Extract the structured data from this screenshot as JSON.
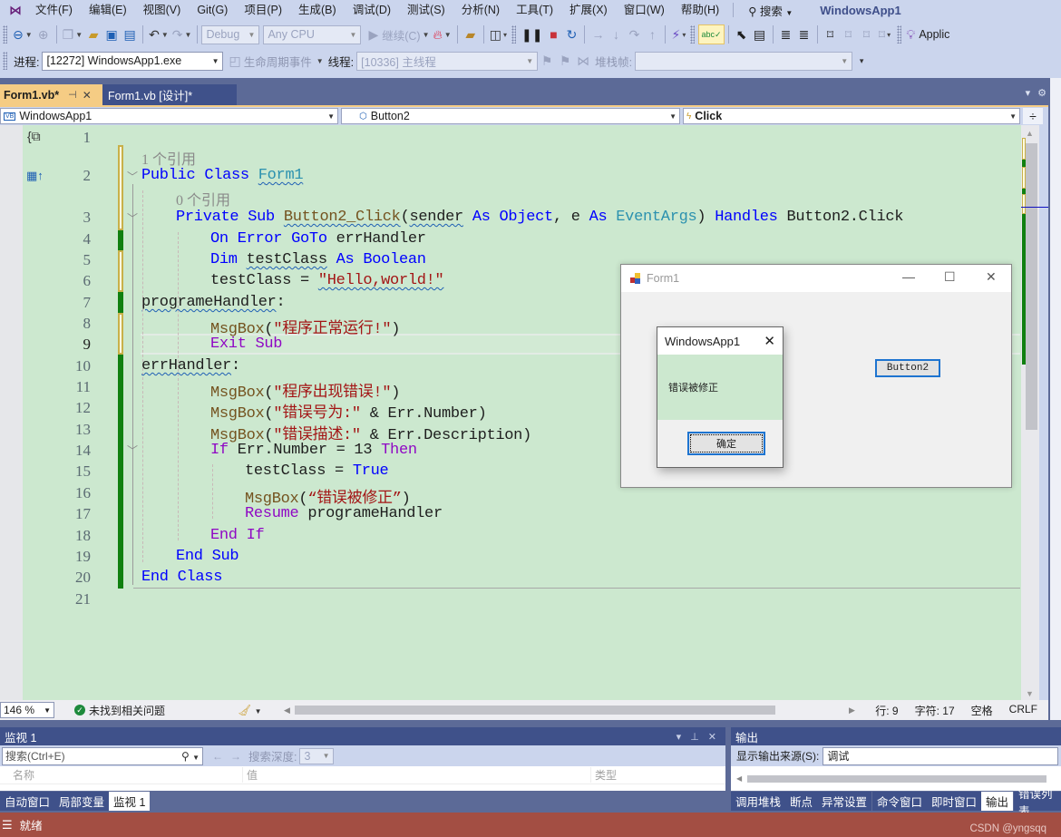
{
  "menubar": {
    "items": [
      "文件(F)",
      "编辑(E)",
      "视图(V)",
      "Git(G)",
      "项目(P)",
      "生成(B)",
      "调试(D)",
      "测试(S)",
      "分析(N)",
      "工具(T)",
      "扩展(X)",
      "窗口(W)",
      "帮助(H)"
    ],
    "search_label": "搜索",
    "app_title": "WindowsApp1"
  },
  "toolbar": {
    "config": "Debug",
    "platform": "Any CPU",
    "continue_label": "继续(C)",
    "applic_label": "Applic"
  },
  "debugbar": {
    "process_label": "进程:",
    "process_value": "[12272] WindowsApp1.exe",
    "lifecycle_label": "生命周期事件",
    "thread_label": "线程:",
    "thread_value": "[10336] 主线程",
    "stackframe_label": "堆栈帧:",
    "stackframe_value": ""
  },
  "tabs": [
    {
      "label": "Form1.vb*",
      "active": true
    },
    {
      "label": "Form1.vb [设计]*",
      "active": false
    }
  ],
  "navbar": {
    "project": "WindowsApp1",
    "object": "Button2",
    "event": "Click"
  },
  "editor": {
    "line_numbers": [
      "1",
      "2",
      "3",
      "4",
      "5",
      "6",
      "7",
      "8",
      "9",
      "10",
      "11",
      "12",
      "13",
      "14",
      "15",
      "16",
      "17",
      "18",
      "19",
      "20",
      "21"
    ],
    "current_line": 9,
    "lens": [
      "1 个引用",
      "0 个引用"
    ],
    "code": {
      "l2": [
        "Public",
        "Class",
        "Form1"
      ],
      "l3": [
        "Private",
        "Sub",
        "Button2_Click",
        "(",
        "sender",
        "As",
        "Object",
        ", e ",
        "As",
        "EventArgs",
        ") ",
        "Handles",
        "Button2.Click"
      ],
      "l4": [
        "On Error GoTo",
        "errHandler"
      ],
      "l5": [
        "Dim",
        "testClass",
        "As",
        "Boolean"
      ],
      "l6": [
        "testClass = ",
        "\"Hello,world!\""
      ],
      "l7": [
        "programeHandler",
        ":"
      ],
      "l8": [
        "MsgBox",
        "(",
        "\"程序正常运行!\"",
        ")"
      ],
      "l9": [
        "Exit Sub"
      ],
      "l10": [
        "errHandler",
        ":"
      ],
      "l11": [
        "MsgBox",
        "(",
        "\"程序出现错误!\"",
        ")"
      ],
      "l12": [
        "MsgBox",
        "(",
        "\"错误号为:\"",
        " & Err.Number)"
      ],
      "l13": [
        "MsgBox",
        "(",
        "\"错误描述:\"",
        " & Err.Description)"
      ],
      "l14": [
        "If",
        " Err.Number = 13 ",
        "Then"
      ],
      "l15": [
        "testClass = ",
        "True"
      ],
      "l16": [
        "MsgBox",
        "(",
        "“错误被修正”",
        ")"
      ],
      "l17": [
        "Resume",
        " programeHandler"
      ],
      "l18": [
        "End If"
      ],
      "l19": [
        "End Sub"
      ],
      "l20": [
        "End Class"
      ]
    }
  },
  "editor_status": {
    "zoom": "146 %",
    "issues": "未找到相关问题",
    "line": "行: 9",
    "char": "字符: 17",
    "indent": "空格",
    "eol": "CRLF"
  },
  "watch": {
    "title": "监视 1",
    "search_placeholder": "搜索(Ctrl+E)",
    "depth_label": "搜索深度:",
    "depth_value": "3",
    "columns": [
      "名称",
      "值",
      "类型"
    ]
  },
  "output": {
    "title": "输出",
    "source_label": "显示输出来源(S):",
    "source_value": "调试"
  },
  "bottom_tabs_left": [
    {
      "label": "自动窗口",
      "active": false
    },
    {
      "label": "局部变量",
      "active": false
    },
    {
      "label": "监视 1",
      "active": true
    }
  ],
  "bottom_tabs_right": [
    {
      "label": "调用堆栈",
      "active": false
    },
    {
      "label": "断点",
      "active": false
    },
    {
      "label": "异常设置",
      "active": false
    },
    {
      "label": "命令窗口",
      "active": false
    },
    {
      "label": "即时窗口",
      "active": false
    },
    {
      "label": "输出",
      "active": true
    },
    {
      "label": "错误列表",
      "active": false
    }
  ],
  "statusbar": {
    "text": "就绪",
    "watermark": "CSDN @yngsqq"
  },
  "form1": {
    "title": "Form1",
    "button_label": "Button2"
  },
  "msgbox": {
    "title": "WindowsApp1",
    "message": "错误被修正",
    "ok_label": "确定"
  }
}
